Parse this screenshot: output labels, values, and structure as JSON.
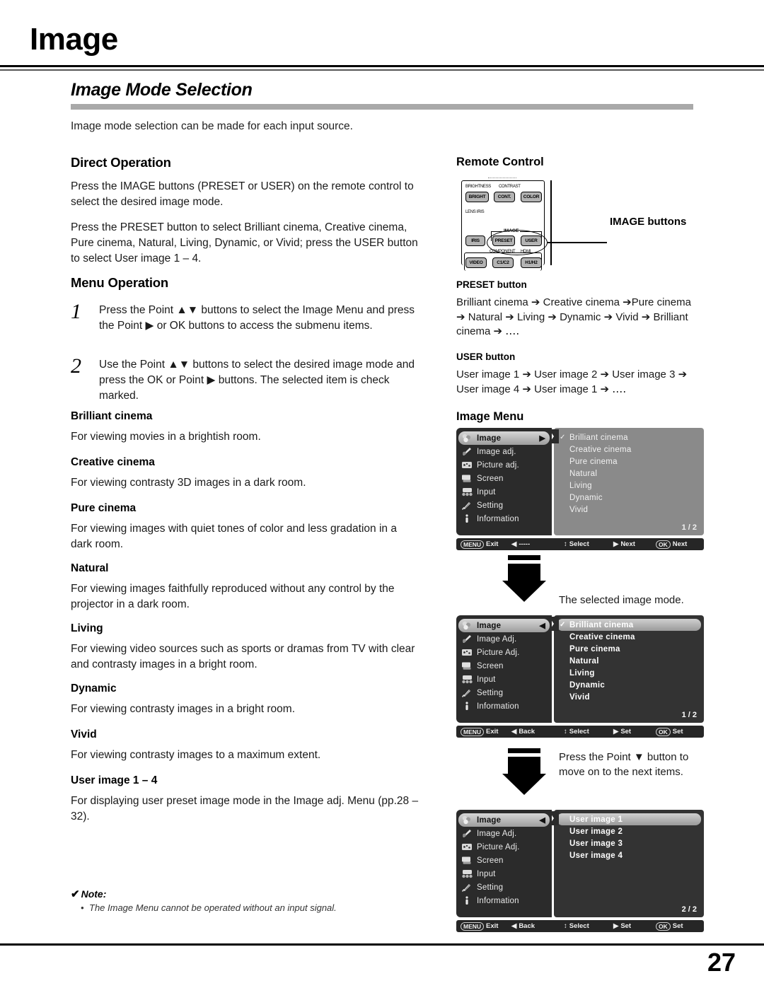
{
  "page": {
    "title": "Image",
    "section_heading": "Image Mode Selection",
    "intro": "Image mode selection can be made for each input source.",
    "number": "27"
  },
  "left": {
    "direct_operation_heading": "Direct Operation",
    "direct_para_1": "Press the IMAGE buttons (PRESET or USER) on the remote control to select the desired image mode.",
    "direct_para_2": "Press the PRESET button to select Brilliant cinema, Creative cinema, Pure cinema, Natural, Living, Dynamic, or Vivid; press the USER button to select User image 1 – 4.",
    "menu_operation_heading": "Menu Operation",
    "steps": [
      {
        "num": "1",
        "text": "Press the Point ▲▼ buttons to select the Image Menu and press the Point ▶ or OK buttons to access the submenu items."
      },
      {
        "num": "2",
        "text": "Use the Point ▲▼ buttons to select the desired image mode and press the OK or Point ▶ buttons. The selected item is check marked."
      }
    ],
    "definitions": [
      {
        "term": "Brilliant cinema",
        "desc": "For viewing movies in a brightish room."
      },
      {
        "term": "Creative cinema",
        "desc": "For viewing contrasty 3D images in a dark room."
      },
      {
        "term": "Pure cinema",
        "desc": "For viewing images with quiet tones of color and less gradation in a dark room."
      },
      {
        "term": "Natural",
        "desc": "For viewing images faithfully reproduced without any control by the projector in a dark room."
      },
      {
        "term": "Living",
        "desc": "For viewing video sources such as sports or dramas from TV with clear and contrasty images in a bright room."
      },
      {
        "term": "Dynamic",
        "desc": "For viewing contrasty images in a bright room."
      },
      {
        "term": "Vivid",
        "desc": "For viewing contrasty images to a maximum extent."
      },
      {
        "term": "User image 1 – 4",
        "desc": "For displaying user preset image mode in the Image adj. Menu (pp.28 – 32)."
      }
    ],
    "note": {
      "check": "✔",
      "title": "Note:",
      "items": [
        "The Image Menu cannot be operated without an input signal."
      ]
    }
  },
  "right": {
    "remote_heading": "Remote Control",
    "remote": {
      "labels": {
        "brightness": "BRIGHTNESS",
        "contrast": "CONTRAST",
        "lens_iris": "LENS IRIS",
        "image": "IMAGE",
        "component": "COMPONENT",
        "hdmi": "HDMI"
      },
      "keys": {
        "bright": "BRIGHT",
        "cont": "CONT.",
        "color": "COLOR",
        "iris": "IRIS",
        "preset": "PRESET",
        "user": "USER",
        "video": "VIDEO",
        "c1c2": "C1/C2",
        "h1h2": "H1/H2"
      },
      "callout": "IMAGE buttons"
    },
    "preset_heading": "PRESET button",
    "preset_flow": "Brilliant cinema ➔ Creative cinema ➔Pure cinema ➔ Natural ➔ Living ➔ Dynamic ➔ Vivid ➔ Brilliant cinema ➔ ․․․․",
    "user_heading": "USER button",
    "user_flow": "User image 1 ➔ User image 2 ➔ User image 3 ➔ User image 4 ➔ User image 1 ➔ ․․․․",
    "image_menu_heading": "Image Menu",
    "caption_selected_mode": "The selected image mode.",
    "caption_next_items": "Press the Point ▼ button to move on to the next items."
  },
  "osd": {
    "menu1": {
      "sidebar": [
        {
          "label": "Image",
          "icon": "image-icon",
          "selected": true,
          "arrow": "▶"
        },
        {
          "label": "Image adj.",
          "icon": "image-adj-icon",
          "selected": false
        },
        {
          "label": "Picture adj.",
          "icon": "picture-adj-icon",
          "selected": false
        },
        {
          "label": "Screen",
          "icon": "screen-icon",
          "selected": false
        },
        {
          "label": "Input",
          "icon": "input-icon",
          "selected": false
        },
        {
          "label": "Setting",
          "icon": "setting-icon",
          "selected": false
        },
        {
          "label": "Information",
          "icon": "information-icon",
          "selected": false
        }
      ],
      "options": [
        {
          "label": "Brilliant cinema",
          "checked": true,
          "highlighted": false
        },
        {
          "label": "Creative cinema",
          "checked": false,
          "highlighted": false
        },
        {
          "label": "Pure cinema",
          "checked": false,
          "highlighted": false
        },
        {
          "label": "Natural",
          "checked": false,
          "highlighted": false
        },
        {
          "label": "Living",
          "checked": false,
          "highlighted": false
        },
        {
          "label": "Dynamic",
          "checked": false,
          "highlighted": false
        },
        {
          "label": "Vivid",
          "checked": false,
          "highlighted": false
        }
      ],
      "page": "1 / 2",
      "bar": {
        "menu_key": "MENU",
        "exit": "Exit",
        "back_arrow": "◀",
        "back": "-----",
        "select_arrow": "↕",
        "select": "Select",
        "next_arrow": "▶",
        "next": "Next",
        "ok_key": "OK",
        "ok_label": "Next"
      }
    },
    "menu2": {
      "sidebar": [
        {
          "label": "Image",
          "icon": "image-icon",
          "selected": true,
          "arrow": "◀"
        },
        {
          "label": "Image Adj.",
          "icon": "image-adj-icon",
          "selected": false
        },
        {
          "label": "Picture Adj.",
          "icon": "picture-adj-icon",
          "selected": false
        },
        {
          "label": "Screen",
          "icon": "screen-icon",
          "selected": false
        },
        {
          "label": "Input",
          "icon": "input-icon",
          "selected": false
        },
        {
          "label": "Setting",
          "icon": "setting-icon",
          "selected": false
        },
        {
          "label": "Information",
          "icon": "information-icon",
          "selected": false
        }
      ],
      "options": [
        {
          "label": "Brilliant cinema",
          "checked": true,
          "highlighted": true
        },
        {
          "label": "Creative cinema",
          "checked": false,
          "highlighted": false
        },
        {
          "label": "Pure cinema",
          "checked": false,
          "highlighted": false
        },
        {
          "label": "Natural",
          "checked": false,
          "highlighted": false
        },
        {
          "label": "Living",
          "checked": false,
          "highlighted": false
        },
        {
          "label": "Dynamic",
          "checked": false,
          "highlighted": false
        },
        {
          "label": "Vivid",
          "checked": false,
          "highlighted": false
        }
      ],
      "page": "1 / 2",
      "bar": {
        "menu_key": "MENU",
        "exit": "Exit",
        "back_arrow": "◀",
        "back": "Back",
        "select_arrow": "↕",
        "select": "Select",
        "next_arrow": "▶",
        "next": "Set",
        "ok_key": "OK",
        "ok_label": "Set"
      }
    },
    "menu3": {
      "sidebar": [
        {
          "label": "Image",
          "icon": "image-icon",
          "selected": true,
          "arrow": "◀"
        },
        {
          "label": "Image Adj.",
          "icon": "image-adj-icon",
          "selected": false
        },
        {
          "label": "Picture Adj.",
          "icon": "picture-adj-icon",
          "selected": false
        },
        {
          "label": "Screen",
          "icon": "screen-icon",
          "selected": false
        },
        {
          "label": "Input",
          "icon": "input-icon",
          "selected": false
        },
        {
          "label": "Setting",
          "icon": "setting-icon",
          "selected": false
        },
        {
          "label": "Information",
          "icon": "information-icon",
          "selected": false
        }
      ],
      "options": [
        {
          "label": "User image 1",
          "checked": false,
          "highlighted": true
        },
        {
          "label": "User image 2",
          "checked": false,
          "highlighted": false
        },
        {
          "label": "User image 3",
          "checked": false,
          "highlighted": false
        },
        {
          "label": "User image 4",
          "checked": false,
          "highlighted": false
        }
      ],
      "page": "2 / 2",
      "bar": {
        "menu_key": "MENU",
        "exit": "Exit",
        "back_arrow": "◀",
        "back": "Back",
        "select_arrow": "↕",
        "select": "Select",
        "next_arrow": "▶",
        "next": "Set",
        "ok_key": "OK",
        "ok_label": "Set"
      }
    }
  }
}
